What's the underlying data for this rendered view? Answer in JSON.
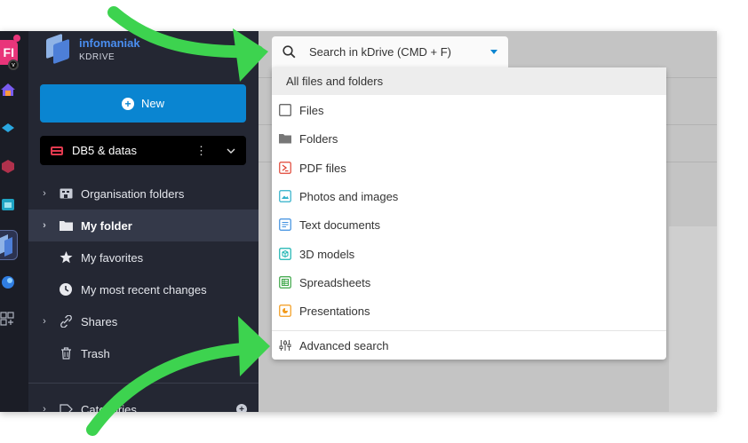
{
  "rail": {
    "workspace_initials": "FI",
    "badge": "v"
  },
  "sidebar": {
    "brand_name": "infomaniak",
    "brand_product": "KDRIVE",
    "new_button_label": "New",
    "drive_name": "DB5 & datas",
    "drive_menu": "⋮",
    "items": [
      {
        "label": "Organisation folders",
        "icon": "building-icon"
      },
      {
        "label": "My folder",
        "icon": "folder-icon"
      },
      {
        "label": "My favorites",
        "icon": "star-icon"
      },
      {
        "label": "My most recent changes",
        "icon": "clock-icon"
      },
      {
        "label": "Shares",
        "icon": "link-icon"
      },
      {
        "label": "Trash",
        "icon": "trash-icon"
      },
      {
        "label": "Categories",
        "icon": "tag-icon"
      }
    ]
  },
  "search": {
    "placeholder": "Search in kDrive (CMD + F)"
  },
  "dropdown": {
    "header": "All files and folders",
    "items": [
      {
        "label": "Files",
        "icon": "file-checkbox-icon"
      },
      {
        "label": "Folders",
        "icon": "folder-icon"
      },
      {
        "label": "PDF files",
        "icon": "pdf-icon"
      },
      {
        "label": "Photos and images",
        "icon": "image-icon"
      },
      {
        "label": "Text documents",
        "icon": "text-document-icon"
      },
      {
        "label": "3D models",
        "icon": "cube-icon"
      },
      {
        "label": "Spreadsheets",
        "icon": "spreadsheet-icon"
      },
      {
        "label": "Presentations",
        "icon": "presentation-icon"
      }
    ],
    "advanced_label": "Advanced search"
  },
  "colors": {
    "accent": "#0a85d1",
    "annotation_arrow": "#3dd34f",
    "sidebar_bg": "#242733",
    "workspace_badge": "#e9357a"
  }
}
